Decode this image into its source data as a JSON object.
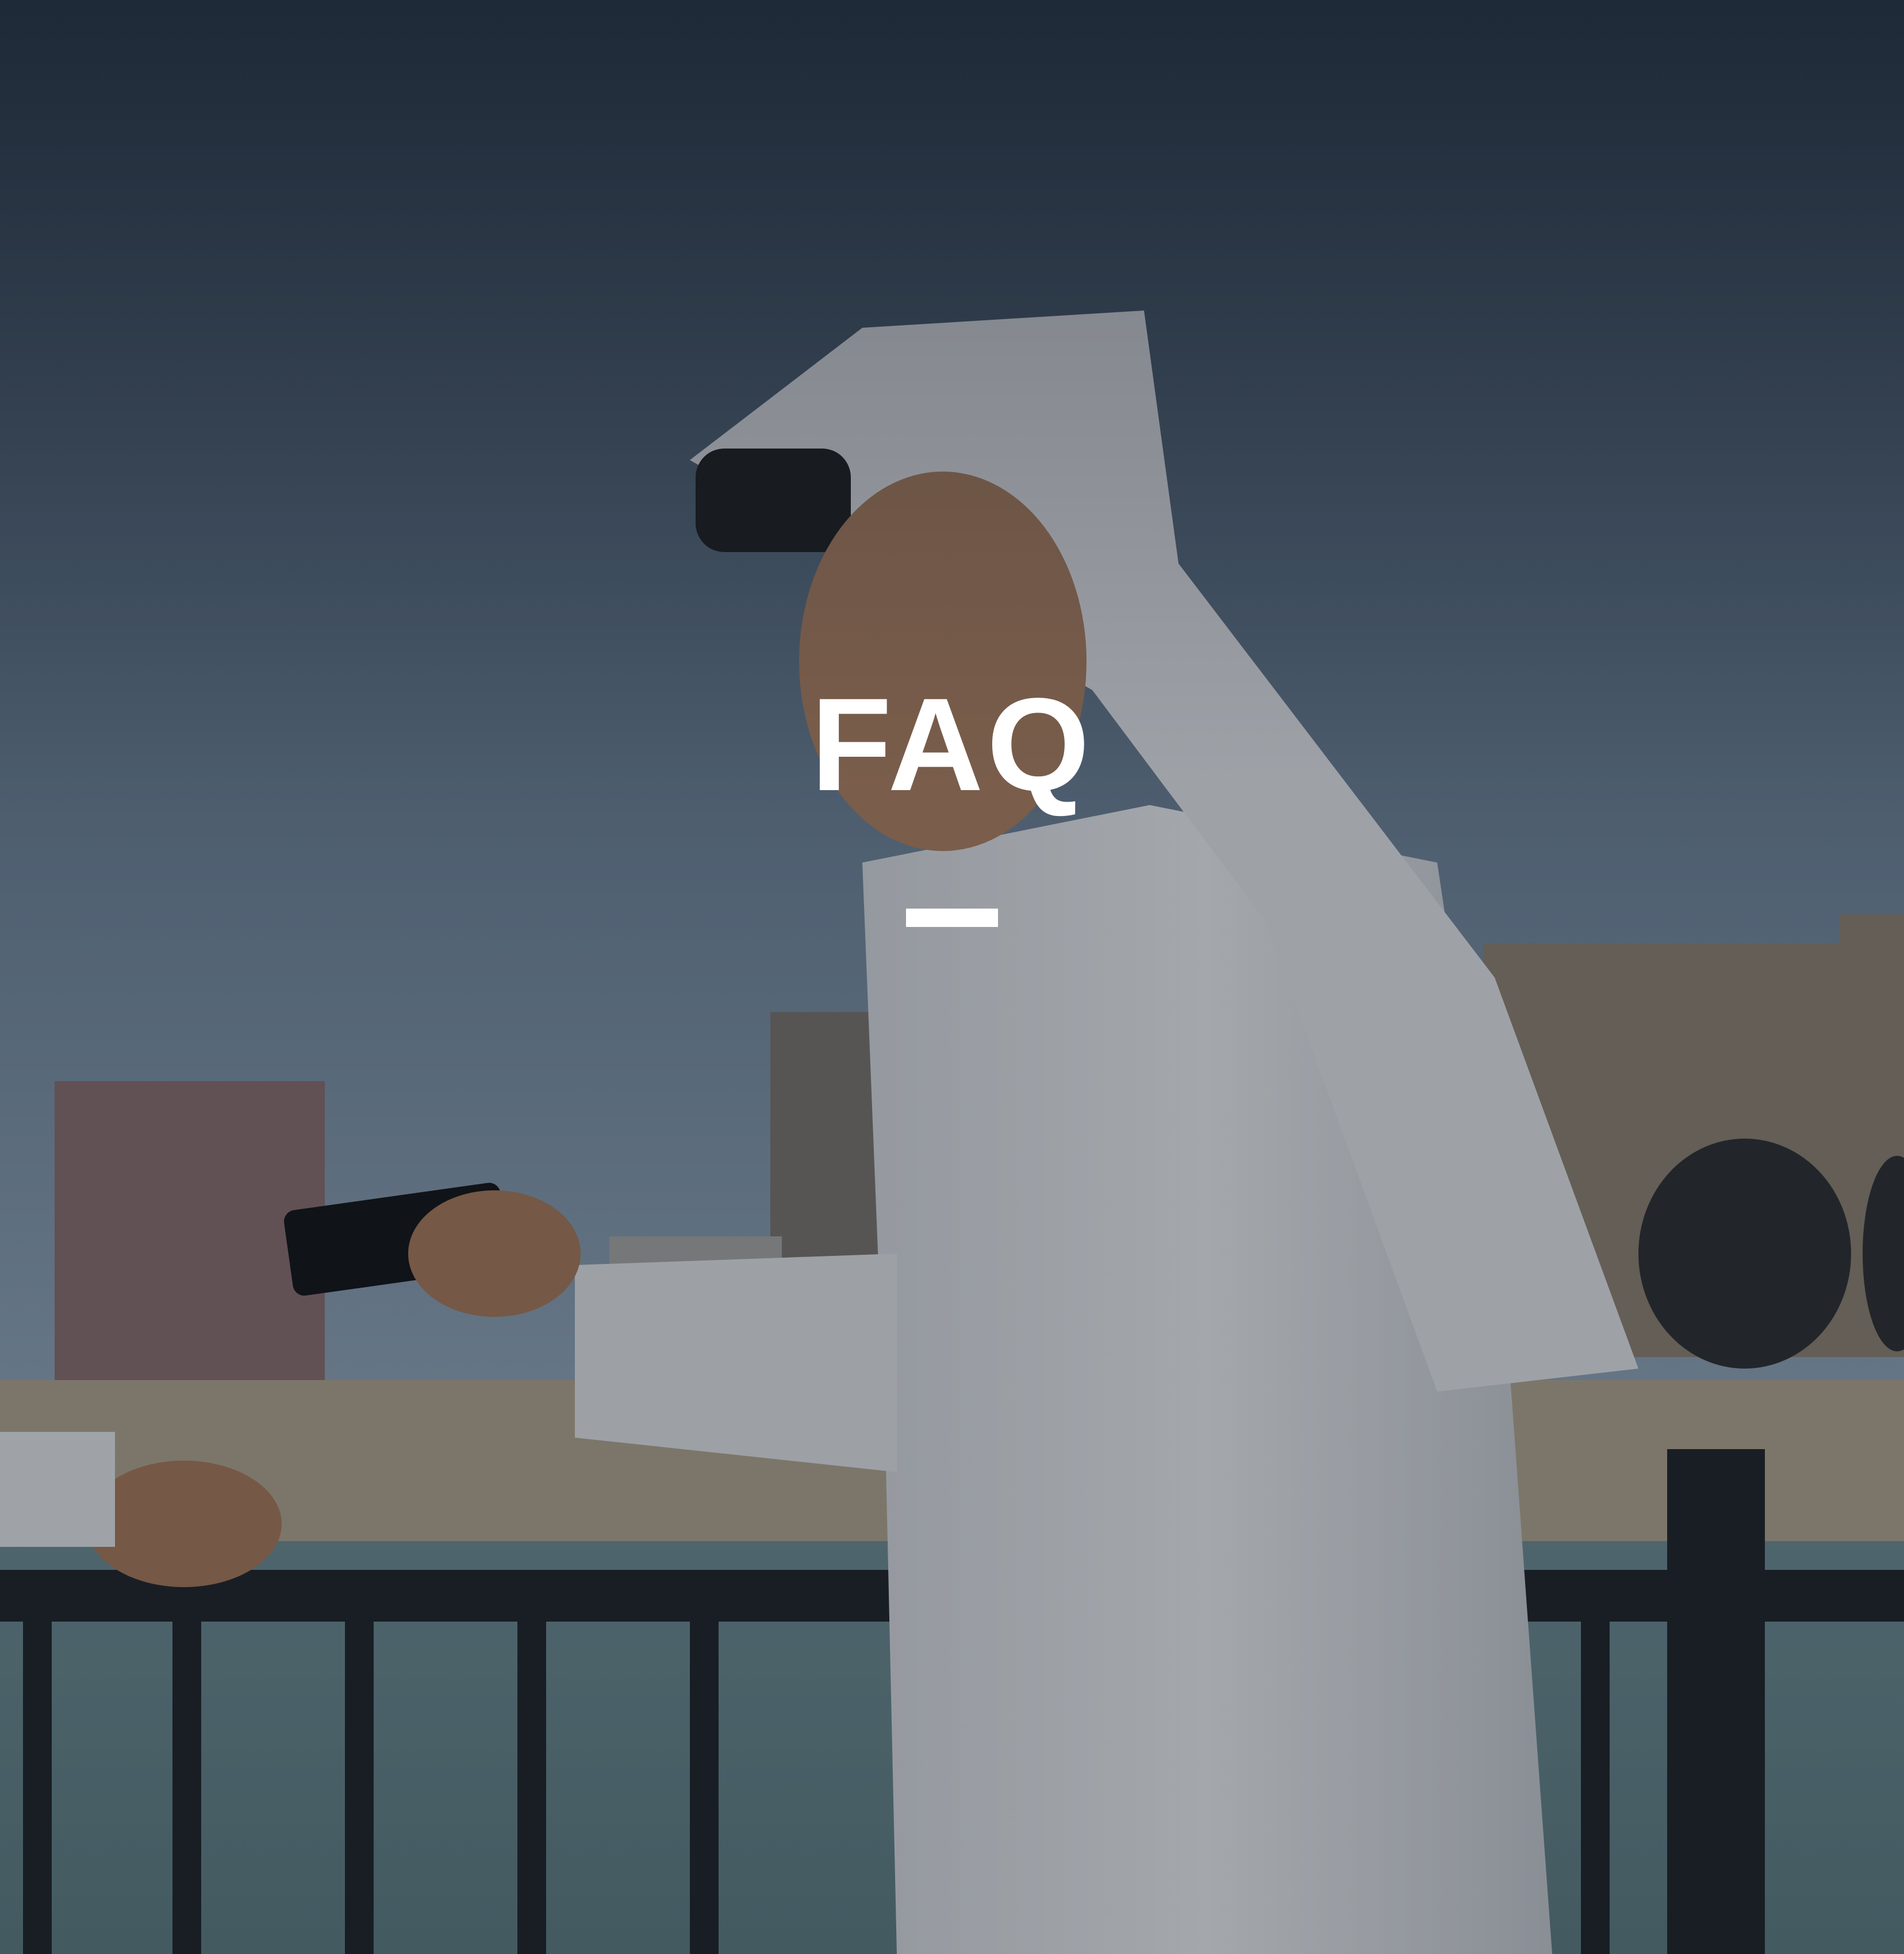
{
  "hero": {
    "title": "FAQ",
    "background_image": "man-in-white-thobe-on-waterfront-photo",
    "accent_color": "#ffffff"
  }
}
